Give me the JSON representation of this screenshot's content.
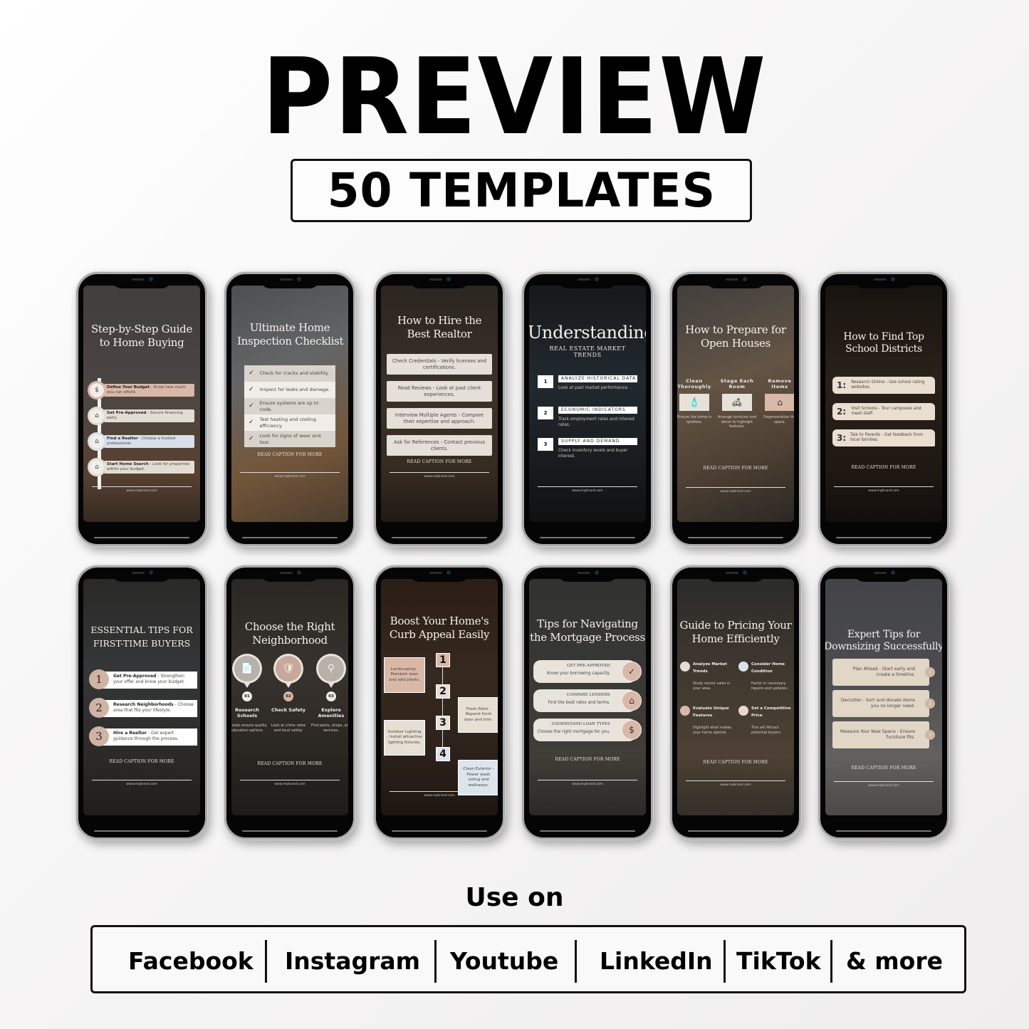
{
  "header": {
    "title": "PREVIEW",
    "subtitle": "50 TEMPLATES"
  },
  "common": {
    "cta": "READ CAPTION FOR MORE",
    "brand_url": "www.mybrand.com"
  },
  "templates": [
    {
      "title_lines": [
        "Step-by-Step Guide",
        "to Home Buying"
      ],
      "items": [
        {
          "bold": "Define Your Budget",
          "text": " - Know how much you can afford.",
          "color": "#d9b8a8",
          "icon": "budget-icon",
          "glyph": "$"
        },
        {
          "bold": "Get Pre-Approved",
          "text": " - Secure financing early.",
          "color": "#e2ddd3",
          "icon": "house-approved-icon",
          "glyph": "⌂"
        },
        {
          "bold": "Find a Realtor",
          "text": " - Choose a trusted professional.",
          "color": "#d7e0ea",
          "icon": "realtor-icon",
          "glyph": "⌂"
        },
        {
          "bold": "Start Home Search",
          "text": " - Look for properties within your budget.",
          "color": "#e2ddd3",
          "icon": "search-home-icon",
          "glyph": "⌂"
        }
      ]
    },
    {
      "title_lines": [
        "Ultimate Home",
        "Inspection Checklist"
      ],
      "items": [
        {
          "text": "Check for cracks and stability."
        },
        {
          "text": "Inspect for leaks and damage."
        },
        {
          "text": "Ensure systems are up to code."
        },
        {
          "text": "Test heating and cooling efficiency."
        },
        {
          "text": "Look for signs of wear and tear."
        }
      ]
    },
    {
      "title_lines": [
        "How to Hire the",
        "Best Realtor"
      ],
      "items": [
        {
          "text": "Check Credentials - Verify licenses and certifications."
        },
        {
          "text": "Read Reviews - Look at past client experiences."
        },
        {
          "text": "Interview Multiple Agents - Compare their expertise and approach."
        },
        {
          "text": "Ask for References - Contact previous clients."
        }
      ]
    },
    {
      "title_lines": [
        "Understanding"
      ],
      "subtitle": "REAL ESTATE MARKET TRENDS",
      "items": [
        {
          "num": "1",
          "heading": "ANALYZE HISTORICAL DATA",
          "text": "Look at past market performance."
        },
        {
          "num": "2",
          "heading": "ECONOMIC INDICATORS",
          "text": "Track employment rates and interest rates."
        },
        {
          "num": "3",
          "heading": "SUPPLY AND DEMAND",
          "text": "Check inventory levels and buyer interest."
        }
      ]
    },
    {
      "title_lines": [
        "How to Prepare for",
        "Open Houses"
      ],
      "items": [
        {
          "heading": "Clean Thoroughly",
          "text": "Ensure the home is spotless.",
          "icon": "cleaning-supplies-icon",
          "glyph": "🧴",
          "color": "#e6e2da"
        },
        {
          "heading": "Stage Each Room",
          "text": "Arrange furniture and decor to highlight features.",
          "icon": "sofa-icon",
          "glyph": "🛋",
          "color": "#e6e2da"
        },
        {
          "heading": "Remove Items",
          "text": "Depersonalize the space.",
          "icon": "house-icon",
          "glyph": "⌂",
          "color": "#d9b8a8"
        }
      ]
    },
    {
      "title_lines": [
        "How to Find Top",
        "School Districts"
      ],
      "items": [
        {
          "num": "1:",
          "text": "Research Online - Use school rating websites."
        },
        {
          "num": "2:",
          "text": "Visit Schools - Tour campuses and meet staff."
        },
        {
          "num": "3:",
          "text": "Talk to Parents - Get feedback from local families."
        }
      ]
    },
    {
      "title_lines": [
        "ESSENTIAL TIPS FOR",
        "FIRST-TIME BUYERS"
      ],
      "items": [
        {
          "num": "1",
          "bold": "Get Pre-Approved",
          "text": " - Strengthen your offer and know your budget."
        },
        {
          "num": "2",
          "bold": "Research Neighborhoods",
          "text": " - Choose area that fits your lifestyle."
        },
        {
          "num": "3",
          "bold": "Hire a Realtor",
          "text": " - Get expert guidance through the process."
        }
      ]
    },
    {
      "title_lines": [
        "Choose the Right",
        "Neighborhood"
      ],
      "items": [
        {
          "num": "01",
          "heading": "Research Schools",
          "text": "It helps ensure quality education options.",
          "icon": "document-search-icon",
          "glyph": "📄",
          "color": "#b8b1a8"
        },
        {
          "num": "02",
          "heading": "Check Safety",
          "text": "Look at crime rates and local safety.",
          "icon": "shield-check-icon",
          "glyph": "🛡",
          "color": "#c7a89a"
        },
        {
          "num": "03",
          "heading": "Explore Amenities",
          "text": "Find parks, shops, and services.",
          "icon": "magnifier-icon",
          "glyph": "⚲",
          "color": "#b8b1a8"
        }
      ]
    },
    {
      "title_lines": [
        "Boost Your Home's",
        "Curb Appeal Easily"
      ],
      "items": [
        {
          "num": "1",
          "text": "Landscaping - Maintain lawn and add plants.",
          "color": "#d9b8a8",
          "side": "left"
        },
        {
          "num": "2",
          "text": "Fresh Paint - Repaint front door and trim.",
          "color": "#e6e0d4",
          "side": "right"
        },
        {
          "num": "3",
          "text": "Outdoor Lighting - Install attractive lighting fixtures.",
          "color": "#e6e0d4",
          "side": "left"
        },
        {
          "num": "4",
          "text": "Clean Exterior - Power wash siding and walkways.",
          "color": "#dce4ee",
          "side": "right"
        }
      ]
    },
    {
      "title_lines": [
        "Tips for Navigating",
        "the Mortgage Process"
      ],
      "items": [
        {
          "heading": "GET PRE-APPROVED",
          "text": "Know your borrowing capacity.",
          "icon": "approved-badge-icon",
          "glyph": "✓"
        },
        {
          "heading": "COMPARE LENDERS",
          "text": "Find the best rates and terms.",
          "icon": "house-tag-icon",
          "glyph": "⌂"
        },
        {
          "heading": "UNDERSTAND LOAN TYPES",
          "text": "Choose the right mortgage for you.",
          "icon": "hand-money-icon",
          "glyph": "$"
        }
      ]
    },
    {
      "title_lines": [
        "Guide to Pricing Your",
        "Home Efficiently"
      ],
      "items": [
        {
          "heading": "Analyze Market Trends",
          "text": "Study recent sales in your area.",
          "color": "#e3ddd2"
        },
        {
          "heading": "Consider Home Condition",
          "text": "Factor in necessary repairs and updates.",
          "color": "#d9e2ec"
        },
        {
          "heading": "Evaluate Unique Features",
          "text": "Highlight what makes your home special.",
          "color": "#d9b8a8"
        },
        {
          "heading": "Set a Competitive Price",
          "text": "This will Attract potential buyers.",
          "color": "#ead8c6"
        }
      ]
    },
    {
      "title_lines": [
        "Expert Tips for",
        "Downsizing Successfully"
      ],
      "items": [
        {
          "num": "1",
          "text": "Plan Ahead - Start early and create a timeline."
        },
        {
          "num": "2",
          "text": "Declutter - Sort and donate items you no longer need."
        },
        {
          "num": "3",
          "text": "Measure Your New Space - Ensure furniture fits."
        }
      ]
    }
  ],
  "use_on": {
    "label": "Use on",
    "platforms": [
      "Facebook",
      "Instagram",
      "Youtube",
      "LinkedIn",
      "TikTok",
      "& more"
    ]
  }
}
